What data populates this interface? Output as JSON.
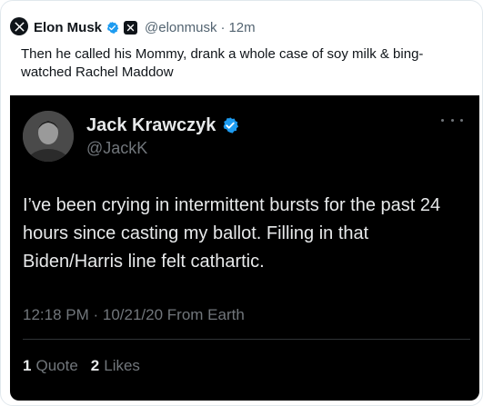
{
  "outer_tweet": {
    "author_name": "Elon Musk",
    "author_handle": "@elonmusk",
    "separator": "·",
    "time": "12m",
    "text": "Then he called his Mommy, drank a whole case of soy milk & bing-watched Rachel Maddow",
    "verified_color": "#1d9bf0",
    "icons": [
      "x-logo-icon",
      "verified-badge-icon",
      "x-affiliate-badge-icon"
    ]
  },
  "quoted_screenshot": {
    "author_name": "Jack Krawczyk",
    "author_handle": "@JackK",
    "text": "I’ve been crying in intermittent bursts for the past 24 hours since casting my ballot. Filling in that Biden/Harris line felt cathartic.",
    "meta": "12:18 PM · 10/21/20 From Earth",
    "stats": [
      {
        "count": "1",
        "label": "Quote"
      },
      {
        "count": "2",
        "label": "Likes"
      }
    ],
    "background": "#000000",
    "icons": [
      "verified-badge-icon",
      "more-options-icon"
    ]
  }
}
